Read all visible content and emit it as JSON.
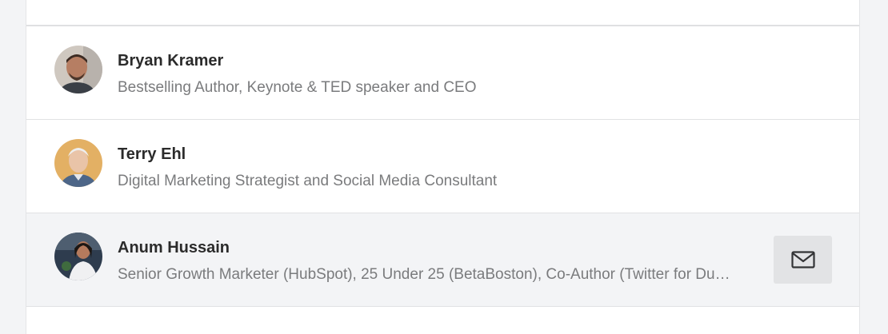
{
  "connections": [
    {
      "name": "Bryan Kramer",
      "headline": "Bestselling Author, Keynote & TED speaker and CEO"
    },
    {
      "name": "Terry Ehl",
      "headline": "Digital Marketing Strategist and Social Media Consultant"
    },
    {
      "name": "Anum Hussain",
      "headline": "Senior Growth Marketer (HubSpot), 25 Under 25 (BetaBoston), Co-Author (Twitter for Dummies)",
      "action_icon": "envelope-icon"
    }
  ],
  "colors": {
    "name_text": "#2b2b2b",
    "headline_text": "#7a7b7d",
    "hover_row": "#f3f4f6",
    "message_button": "#e2e3e5"
  }
}
